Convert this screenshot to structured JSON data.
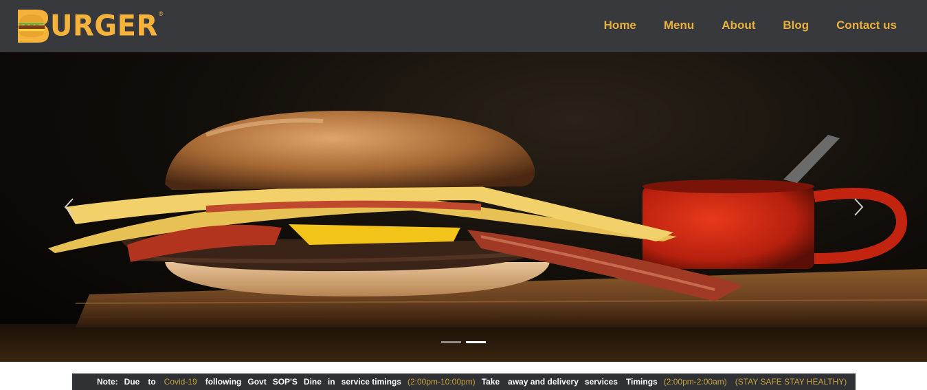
{
  "header": {
    "logo_text": "URGER",
    "logo_full": "BURGER",
    "logo_reg": "®",
    "nav": [
      {
        "label": "Home"
      },
      {
        "label": "Menu"
      },
      {
        "label": "About"
      },
      {
        "label": "Blog"
      },
      {
        "label": "Contact us"
      }
    ]
  },
  "carousel": {
    "prev_icon": "chevron-left-icon",
    "next_icon": "chevron-right-icon",
    "slides": 2,
    "active_slide": 2
  },
  "ticker": {
    "note": "Note:",
    "due": "Due",
    "to": "to",
    "covid": "Covid-19",
    "following": "following",
    "govt": "Govt",
    "sops": "SOP'S",
    "dine": "Dine",
    "in": "in",
    "service_timings": "service timings",
    "dine_hours": "(2:00pm-10:00pm)",
    "take": "Take",
    "away_delivery": "away and delivery",
    "services": "services",
    "timings": "Timings",
    "delivery_hours": "(2:00pm-2:00am)",
    "stay_safe": "(STAY SAFE STAY HEALTHY)"
  },
  "colors": {
    "header_bg": "#37393d",
    "accent_gold": "#e9b03d",
    "ticker_bg": "#2f3135"
  }
}
